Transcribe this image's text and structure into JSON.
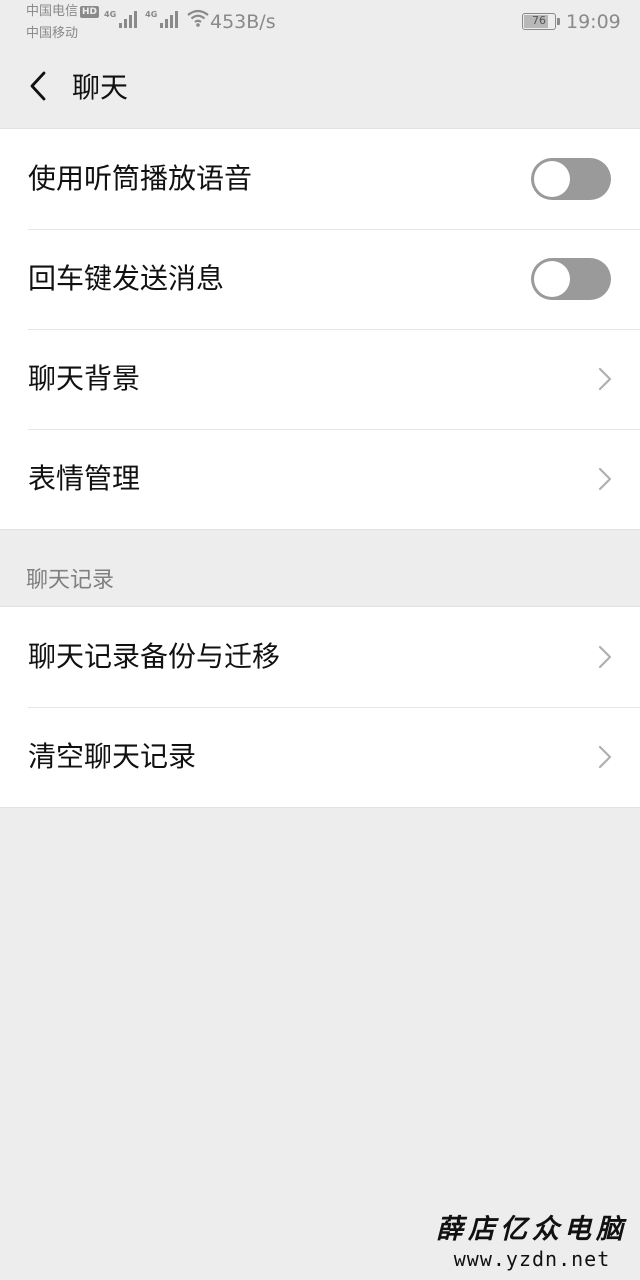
{
  "status_bar": {
    "carrier_1": "中国电信",
    "hd_badge": "HD",
    "carrier_2": "中国移动",
    "network_1": "4G",
    "network_2": "4G",
    "net_speed": "453B/s",
    "battery_level": "76",
    "time": "19:09",
    "icons": [
      "signal-icon",
      "wifi-icon",
      "battery-icon"
    ]
  },
  "header": {
    "title": "聊天",
    "back_icon": "chevron-left-icon"
  },
  "settings": {
    "group_1": [
      {
        "label": "使用听筒播放语音",
        "control": "toggle",
        "state": "off"
      },
      {
        "label": "回车键发送消息",
        "control": "toggle",
        "state": "off"
      },
      {
        "label": "聊天背景",
        "control": "chevron-right-icon"
      },
      {
        "label": "表情管理",
        "control": "chevron-right-icon"
      }
    ],
    "section_header": "聊天记录",
    "group_2": [
      {
        "label": "聊天记录备份与迁移",
        "control": "chevron-right-icon"
      },
      {
        "label": "清空聊天记录",
        "control": "chevron-right-icon"
      }
    ]
  },
  "watermark": {
    "title": "薛店亿众电脑",
    "url": "www.yzdn.net"
  },
  "colors": {
    "background": "#ededed",
    "surface": "#ffffff",
    "toggle_off": "#9a9a9a",
    "secondary_text": "#808080"
  }
}
